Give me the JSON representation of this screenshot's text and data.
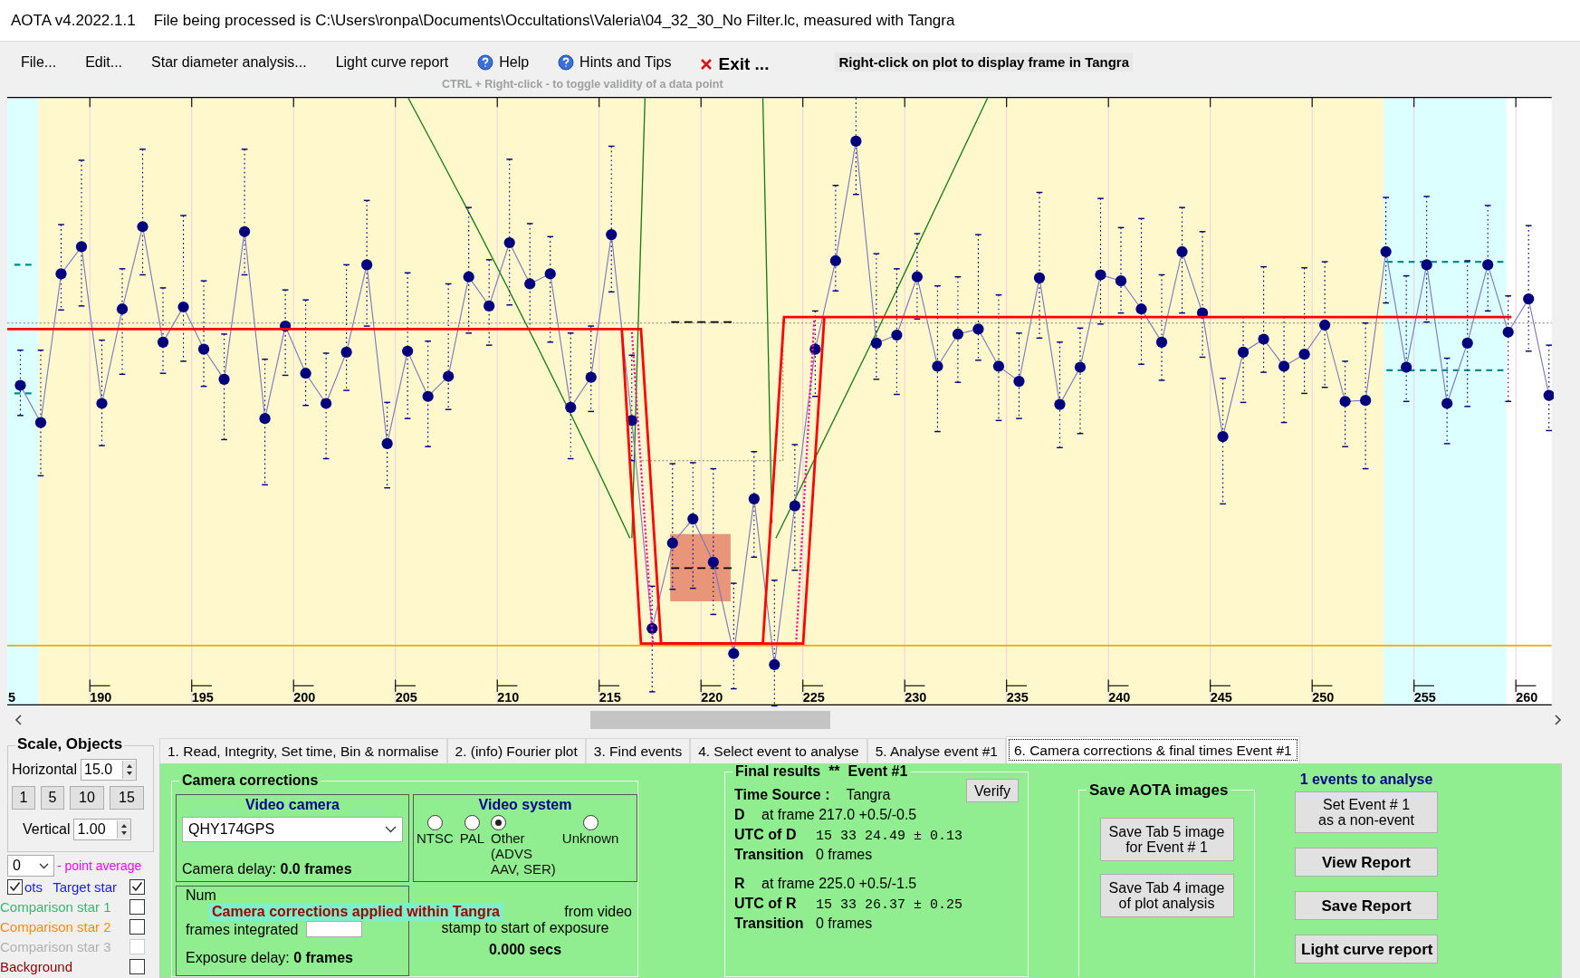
{
  "window": {
    "app_title": "AOTA v4.2022.1.1",
    "file_info": "File being processed is C:\\Users\\ronpa\\Documents\\Occultations\\Valeria\\04_32_30_No Filter.lc, measured with Tangra"
  },
  "menu": [
    {
      "label": "File...",
      "kind": "plain"
    },
    {
      "label": "Edit...",
      "kind": "plain"
    },
    {
      "label": "Star diameter analysis...",
      "kind": "plain"
    },
    {
      "label": "Light curve report",
      "kind": "plain"
    },
    {
      "label": "Help",
      "kind": "help"
    },
    {
      "label": "Hints and Tips",
      "kind": "help"
    },
    {
      "label": "Exit ...",
      "kind": "exit"
    }
  ],
  "plot_hint": "Right-click on plot to display frame in Tangra",
  "plot_subhint": "CTRL + Right-click  -  to toggle validity of a data point",
  "plot": {
    "x_tick_labels": [
      "5",
      "190",
      "195",
      "200",
      "205",
      "210",
      "215",
      "220",
      "225",
      "230",
      "235",
      "240",
      "245",
      "250",
      "255",
      "260"
    ]
  },
  "scale_panel": {
    "title": "Scale,  Objects",
    "horizontal_label": "Horizontal",
    "horizontal_value": "15.0",
    "scale_buttons": [
      "1",
      "5",
      "10",
      "15"
    ],
    "vertical_label": "Vertical",
    "vertical_value": "1.00",
    "average_value": "0",
    "average_label": "- point average",
    "objects": [
      {
        "label": "Target star",
        "kind": "target",
        "checked": true,
        "disabled": false
      },
      {
        "label": "Comparison star 1",
        "kind": "comp1",
        "checked": false,
        "disabled": false
      },
      {
        "label": "Comparison star 2",
        "kind": "comp2",
        "checked": false,
        "disabled": false
      },
      {
        "label": "Comparison star 3",
        "kind": "comp3",
        "checked": false,
        "disabled": true
      },
      {
        "label": "Background",
        "kind": "background",
        "checked": false,
        "disabled": false
      }
    ],
    "plots_label": "ots",
    "plots_checked": true
  },
  "tabs": [
    {
      "label": "1.  Read, Integrity, Set time, Bin & normalise",
      "selected": false
    },
    {
      "label": "2. (info)  Fourier plot",
      "selected": false
    },
    {
      "label": "3. Find events",
      "selected": false
    },
    {
      "label": "4. Select event to analyse",
      "selected": false
    },
    {
      "label": "5. Analyse event #1",
      "selected": false
    },
    {
      "label": "6. Camera corrections & final times Event #1",
      "selected": true
    }
  ],
  "camera_corrections": {
    "title": "Camera corrections",
    "video_camera": {
      "title": "Video camera",
      "value": "QHY174GPS",
      "delay_label": "Camera delay:",
      "delay_value": "0.0 frames"
    },
    "video_system": {
      "title": "Video system",
      "options": [
        {
          "label": "NTSC",
          "selected": false
        },
        {
          "label": "PAL",
          "selected": false
        },
        {
          "label": "Other\n(ADVS\nAAV, SER)",
          "selected": true
        },
        {
          "label": "Unknown",
          "selected": false
        }
      ]
    },
    "integration": {
      "label_top": "Num",
      "label_bottom": "frames integrated",
      "exposure_label": "Exposure delay:",
      "exposure_value": "0 frames"
    },
    "offset": {
      "line_1": "from video",
      "line_2": "stamp to start of exposure",
      "value": "0.000 secs"
    },
    "tooltip": "Camera corrections applied within Tangra"
  },
  "final_results": {
    "title": "Final results  **  Event #1",
    "verify_button": "Verify",
    "time_source_label": "Time Source :",
    "time_source": "Tangra",
    "events": [
      {
        "label": "D",
        "frame": "at frame 217.0  +0.5/-0.5",
        "utc_label": "UTC of D",
        "utc": "15 33 24.49  ± 0.13",
        "transition_label": "Transition",
        "transition": "0 frames"
      },
      {
        "label": "R",
        "frame": "at frame 225.0  +0.5/-1.5",
        "utc_label": "UTC of R",
        "utc": "15 33 26.37  ± 0.25",
        "transition_label": "Transition",
        "transition": "0 frames"
      }
    ]
  },
  "save_images": {
    "title": "Save AOTA images",
    "buttons": [
      "Save Tab 5 image\nfor Event # 1",
      "Save Tab 4 image\nof plot analysis"
    ]
  },
  "actions": {
    "events_count": "1  events to analyse",
    "non_event_button": "Set Event # 1\nas a non-event",
    "bold_buttons": [
      "View Report",
      "Save Report",
      "Light curve report"
    ]
  }
}
